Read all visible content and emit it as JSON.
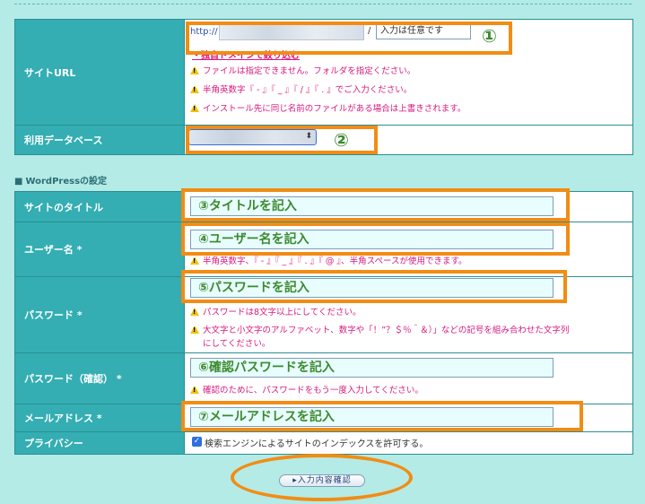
{
  "site_url": {
    "label": "サイトURL",
    "prefix": "http://",
    "slash": "/",
    "dir_placeholder": "入力は任意です",
    "link": "・独自ドメインで絞り込む",
    "notes": [
      "ファイルは指定できません。フォルダを指定ください。",
      "半角英数字『 - 』『 _ 』『 / 』『 . 』でご入力ください。",
      "インストール先に同じ名前のファイルがある場合は上書きされます。"
    ],
    "callout": "①"
  },
  "database": {
    "label": "利用データベース",
    "callout": "②"
  },
  "section_title": "WordPressの設定",
  "site_title": {
    "label": "サイトのタイトル",
    "value": "③タイトルを記入"
  },
  "username": {
    "label": "ユーザー名 *",
    "value": "④ユーザー名を記入",
    "note": "半角英数字、『 - 』『 _ 』『 . 』『 @ 』、半角スペースが使用できます。"
  },
  "password": {
    "label": "パスワード *",
    "value": "⑤パスワードを記入",
    "note1": "パスワードは8文字以上にしてください。",
    "note2": "大文字と小文字のアルファベット、数字や「！”？＄％＾＆）」などの記号を組み合わせた文字列",
    "note2_cont": "にしてください。"
  },
  "password_confirm": {
    "label": "パスワード（確認） *",
    "value": "⑥確認パスワードを記入",
    "note": "確認のために、パスワードをもう一度入力してください。"
  },
  "email": {
    "label": "メールアドレス *",
    "value": "⑦メールアドレスを記入"
  },
  "privacy": {
    "label": "プライバシー",
    "checkbox_label": "検索エンジンによるサイトのインデックスを許可する。",
    "checked": true
  },
  "confirm_button": "▸入力内容確認",
  "colors": {
    "label_bg": "#34aeb2",
    "page_bg": "#b4ebe6",
    "accent_orange": "#f28c14",
    "note_red": "#d6197f"
  },
  "icons": {
    "warning": "warning-icon",
    "check": "checkbox-checked-icon"
  }
}
